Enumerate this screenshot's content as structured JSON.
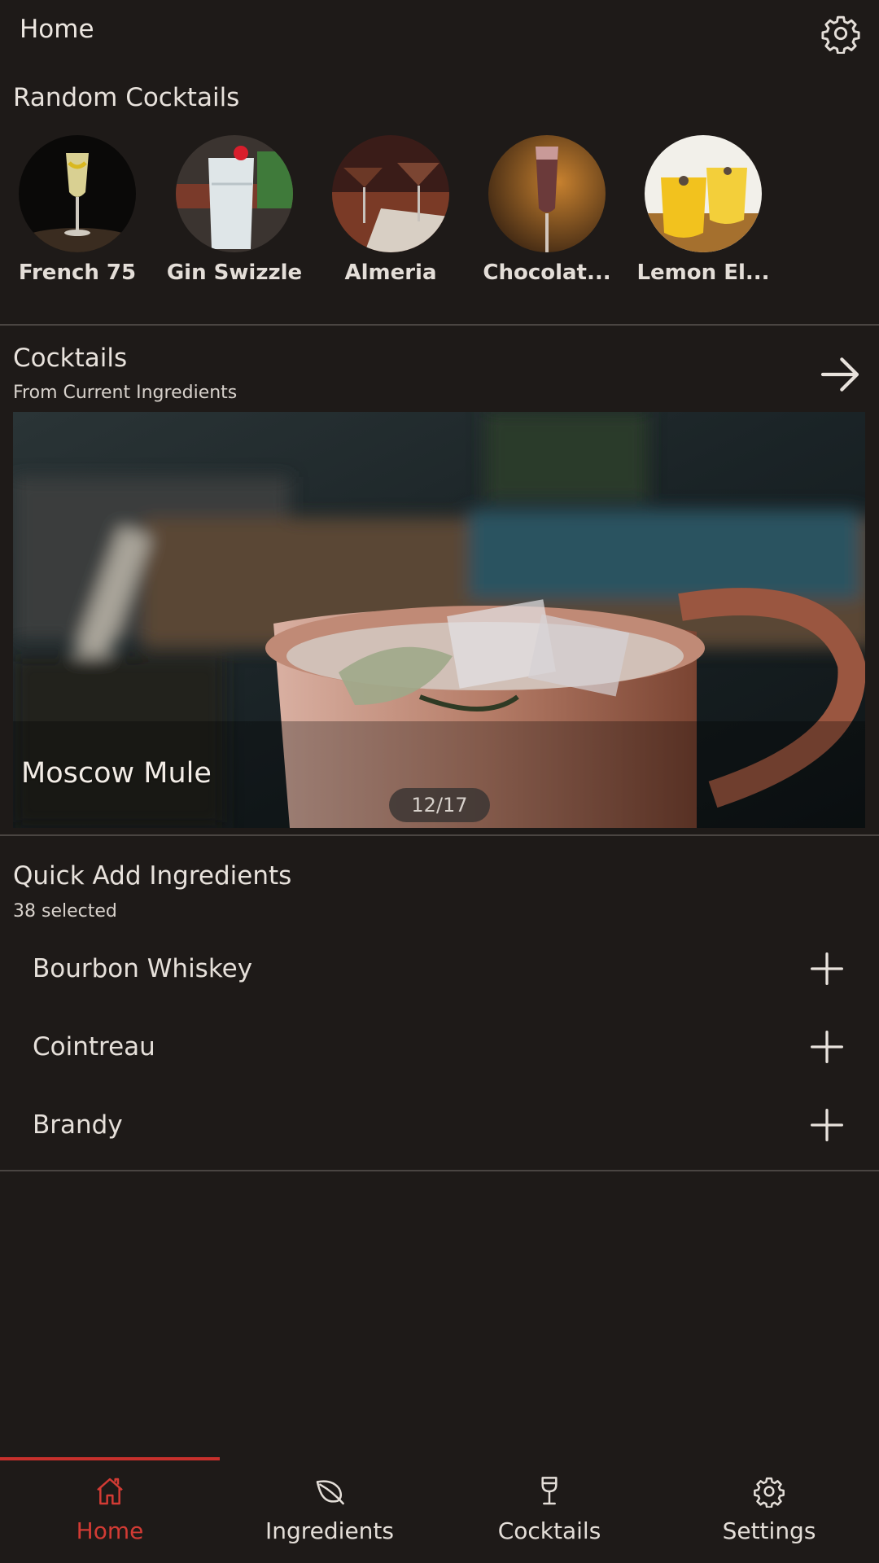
{
  "header": {
    "title": "Home",
    "settings_icon": "gear-icon"
  },
  "random": {
    "title": "Random Cocktails",
    "items": [
      {
        "name": "French 75"
      },
      {
        "name": "Gin Swizzle"
      },
      {
        "name": "Almeria"
      },
      {
        "name": "Chocolat..."
      },
      {
        "name": "Lemon El..."
      }
    ]
  },
  "cocktails": {
    "title": "Cocktails",
    "subtitle": "From Current Ingredients",
    "arrow_icon": "arrow-right-icon",
    "featured": {
      "name": "Moscow Mule",
      "counter": "12/17"
    }
  },
  "quick_add": {
    "title": "Quick Add Ingredients",
    "subtitle": "38 selected",
    "items": [
      {
        "label": "Bourbon Whiskey"
      },
      {
        "label": "Cointreau"
      },
      {
        "label": "Brandy"
      }
    ]
  },
  "nav": {
    "items": [
      {
        "label": "Home",
        "icon": "home-icon",
        "active": true
      },
      {
        "label": "Ingredients",
        "icon": "leaf-icon",
        "active": false
      },
      {
        "label": "Cocktails",
        "icon": "cocktail-glass-icon",
        "active": false
      },
      {
        "label": "Settings",
        "icon": "gear-icon",
        "active": false
      }
    ]
  },
  "colors": {
    "background": "#1e1a18",
    "accent": "#c7302c",
    "text": "#e2dcd6"
  }
}
